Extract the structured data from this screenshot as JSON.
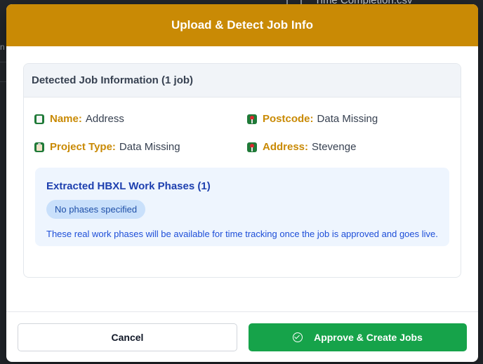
{
  "background": {
    "filename": "Time Completion.csv",
    "side_glyph": "n"
  },
  "modal": {
    "title": "Upload & Detect Job Info",
    "header_color": "#c98a05"
  },
  "card": {
    "title": "Detected Job Information (1 job)",
    "fields": [
      {
        "icon": "document-icon",
        "label": "Name:",
        "value": "Address"
      },
      {
        "icon": "map-pin-icon",
        "label": "Postcode:",
        "value": "Data Missing"
      },
      {
        "icon": "clipboard-icon",
        "label": "Project Type:",
        "value": "Data Missing"
      },
      {
        "icon": "map-pin-icon",
        "label": "Address:",
        "value": "Stevenge"
      }
    ]
  },
  "phases": {
    "title": "Extracted HBXL Work Phases (1)",
    "pill": "No phases specified",
    "note": "These real work phases will be available for time tracking once the job is approved and goes live."
  },
  "footer": {
    "cancel_label": "Cancel",
    "approve_label": "Approve & Create Jobs",
    "approve_color": "#16a34a"
  }
}
